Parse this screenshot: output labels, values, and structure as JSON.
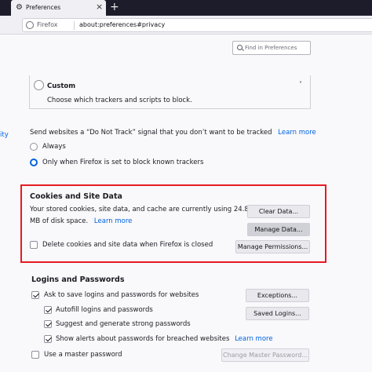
{
  "browser": {
    "tab_title": "Preferences",
    "tab_icon": "gear-icon",
    "tab_close": "×",
    "new_tab": "+",
    "identity_label": "Firefox",
    "url": "about:preferences#privacy"
  },
  "search": {
    "placeholder": "Find in Preferences"
  },
  "sidebar_fragment": "ity",
  "custom": {
    "title": "Custom",
    "description": "Choose which trackers and scripts to block.",
    "chevron": "˅"
  },
  "dnt": {
    "text": "Send websites a “Do Not Track” signal that you don’t want to be tracked",
    "learn_more": "Learn more",
    "options": [
      {
        "label": "Always",
        "checked": false
      },
      {
        "label": "Only when Firefox is set to block known trackers",
        "checked": true
      }
    ]
  },
  "cookies": {
    "title": "Cookies and Site Data",
    "line1": "Your stored cookies, site data, and cache are currently using 24.8",
    "line2": "MB of disk space.",
    "learn_more": "Learn more",
    "clear_button": "Clear Data...",
    "manage_button": "Manage Data...",
    "permissions_button": "Manage Permissions...",
    "delete_checkbox": "Delete cookies and site data when Firefox is closed"
  },
  "logins": {
    "title": "Logins and Passwords",
    "ask_save": "Ask to save logins and passwords for websites",
    "autofill": "Autofill logins and passwords",
    "suggest": "Suggest and generate strong passwords",
    "alerts": "Show alerts about passwords for breached websites",
    "learn_more": "Learn more",
    "exceptions_button": "Exceptions...",
    "saved_button": "Saved Logins...",
    "master_password": "Use a master password",
    "change_master_button": "Change Master Password..."
  },
  "colors": {
    "accent": "#0061e0",
    "highlight": "#e41b23"
  }
}
